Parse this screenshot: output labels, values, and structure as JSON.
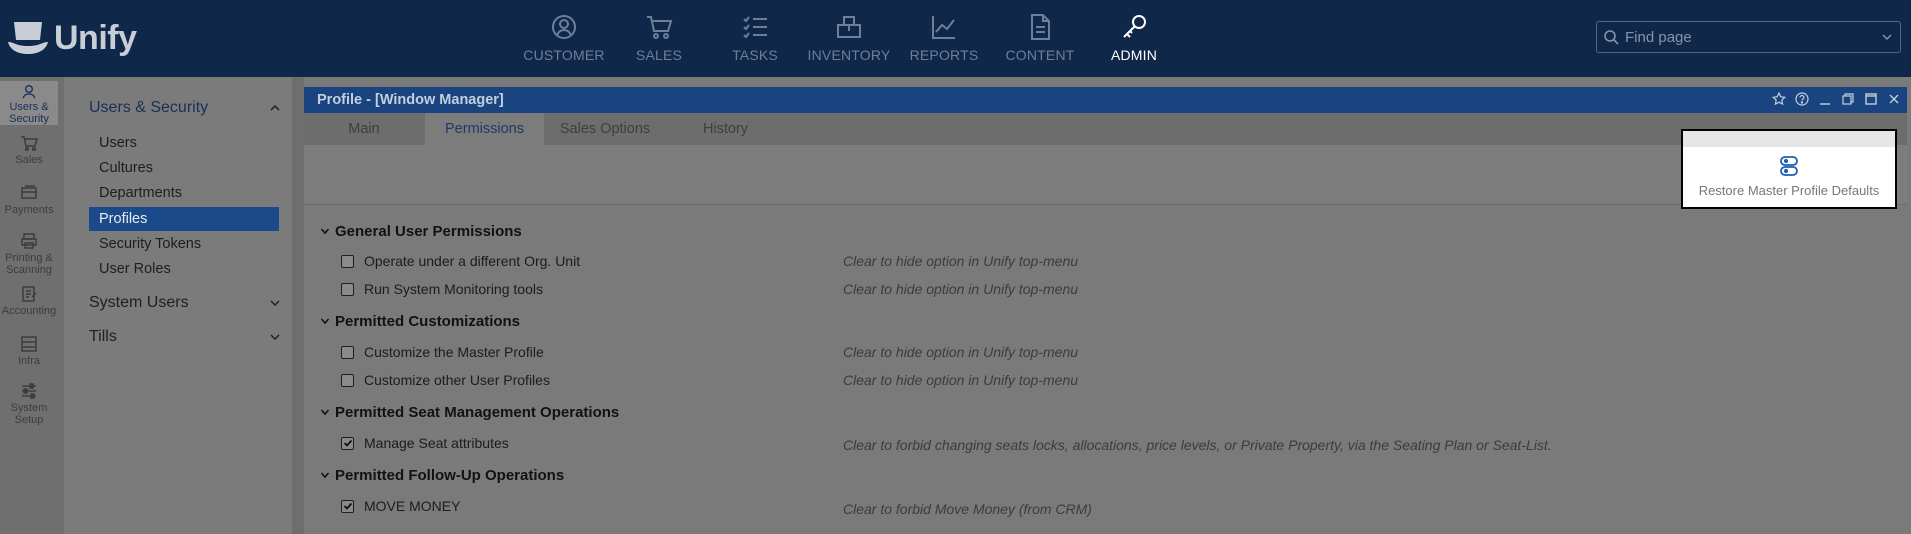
{
  "app": {
    "name": "Unify"
  },
  "top_nav": [
    {
      "label": "CUSTOMER",
      "icon": "customer-icon",
      "active": false
    },
    {
      "label": "SALES",
      "icon": "cart-icon",
      "active": false
    },
    {
      "label": "TASKS",
      "icon": "tasks-icon",
      "active": false
    },
    {
      "label": "INVENTORY",
      "icon": "inventory-icon",
      "active": false
    },
    {
      "label": "REPORTS",
      "icon": "reports-icon",
      "active": false
    },
    {
      "label": "CONTENT",
      "icon": "content-icon",
      "active": false
    },
    {
      "label": "ADMIN",
      "icon": "key-icon",
      "active": true
    }
  ],
  "search": {
    "placeholder": "Find page"
  },
  "rail": [
    {
      "label": "Users & Security",
      "icon": "user-icon",
      "active": true
    },
    {
      "label": "Sales",
      "icon": "cart-icon",
      "active": false
    },
    {
      "label": "Payments",
      "icon": "payments-icon",
      "active": false
    },
    {
      "label": "Printing & Scanning",
      "icon": "printer-icon",
      "active": false
    },
    {
      "label": "Accounting",
      "icon": "accounting-icon",
      "active": false
    },
    {
      "label": "Infra",
      "icon": "infra-icon",
      "active": false
    },
    {
      "label": "System Setup",
      "icon": "sliders-icon",
      "active": false
    }
  ],
  "subnav": {
    "group_title": "Users & Security",
    "items": [
      "Users",
      "Cultures",
      "Departments",
      "Profiles",
      "Security Tokens",
      "User Roles"
    ],
    "active_item": "Profiles",
    "other_groups": [
      "System Users",
      "Tills"
    ]
  },
  "window": {
    "title": "Profile - [Window Manager]",
    "tabs": [
      "Main",
      "Permissions",
      "Sales Options",
      "History"
    ],
    "active_tab": "Permissions"
  },
  "toolbar": {
    "restore_label": "Restore Master Profile Defaults"
  },
  "sections": [
    {
      "title": "General User Permissions",
      "options": [
        {
          "label": "Operate under a different Org. Unit",
          "checked": false,
          "hint": "Clear to hide option in Unify top-menu"
        },
        {
          "label": "Run System Monitoring tools",
          "checked": false,
          "hint": "Clear to hide option in Unify top-menu"
        }
      ]
    },
    {
      "title": "Permitted Customizations",
      "options": [
        {
          "label": "Customize the Master Profile",
          "checked": false,
          "hint": "Clear to hide option in Unify top-menu"
        },
        {
          "label": "Customize other User Profiles",
          "checked": false,
          "hint": "Clear to hide option in Unify top-menu"
        }
      ]
    },
    {
      "title": "Permitted Seat Management Operations",
      "options": [
        {
          "label": "Manage Seat attributes",
          "checked": true,
          "hint": "Clear to forbid changing seats locks, allocations, price levels, or Private Property, via the Seating Plan or Seat-List."
        }
      ]
    },
    {
      "title": "Permitted Follow-Up Operations",
      "options": [
        {
          "label": "MOVE MONEY",
          "checked": true,
          "hint": "Clear to forbid Move Money (from CRM)"
        }
      ]
    }
  ],
  "colors": {
    "topbar": "#0f2748",
    "title_bar": "#1a4480",
    "active_item": "#1a4a8a",
    "highlight_border": "#000000"
  }
}
